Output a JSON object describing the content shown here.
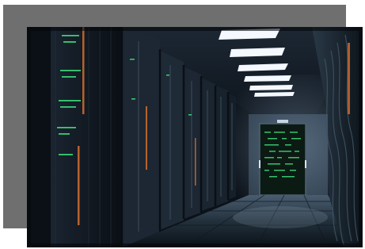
{
  "image": {
    "kind": "photo",
    "subject": "server-room",
    "colors": {
      "frame": "#6f6f6f",
      "background": "#ffffff",
      "ambient": "#0b1118",
      "light": "#f4f8ff",
      "led_green": "#3fe07a",
      "led_orange": "#e0742f"
    }
  }
}
